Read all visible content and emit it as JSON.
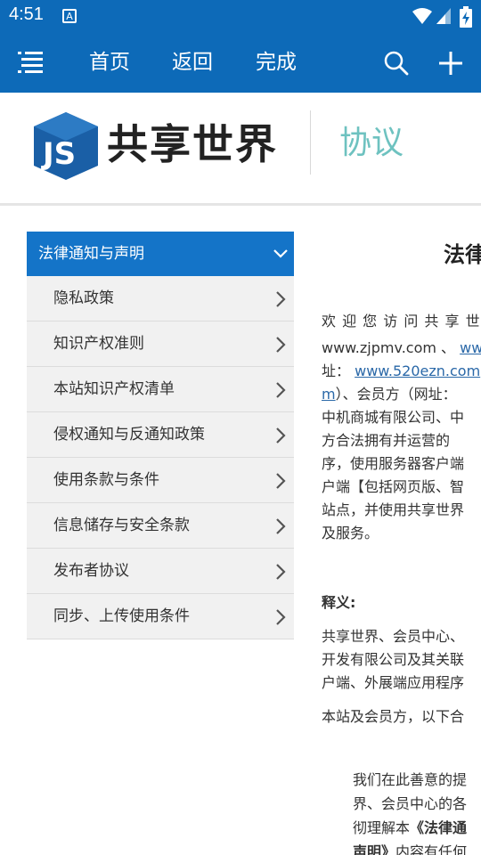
{
  "status_bar": {
    "time": "4:51",
    "notification_glyph": "A"
  },
  "toolbar": {
    "home": "首页",
    "back": "返回",
    "done": "完成"
  },
  "brand": {
    "logo_text": "共享世界",
    "section_label": "协议"
  },
  "sidebar": {
    "header": "法律通知与声明",
    "items": [
      "隐私政策",
      "知识产权准则",
      "本站知识产权清单",
      "侵权通知与反通知政策",
      "使用条款与条件",
      "信息储存与安全条款",
      "发布者协议",
      "同步、上传使用条件"
    ]
  },
  "content": {
    "title": "法律",
    "intro_lines": [
      "欢 迎 您 访 问 共 享 世",
      "www.zjpmv.com 、",
      "ww",
      "址：",
      "www.520ezn.com",
      "m",
      "）、会员方（网址：",
      "中机商城有限公司、中",
      "方合法拥有并运营的",
      "序，使用服务器客户端",
      "户端【包括网页版、智",
      "站点，并使用共享世界",
      "及服务。"
    ],
    "definitions_heading": "释义:",
    "definition_lines": [
      "共享世界、会员中心、",
      "开发有限公司及其关联",
      "户端、外展端应用程序"
    ],
    "members_line": "本站及会员方，以下合",
    "notice_lines": [
      "我们在此善意的提",
      "界、会员中心的各",
      "彻理解本",
      "《法律通",
      "声明》",
      "内容有任何"
    ]
  }
}
